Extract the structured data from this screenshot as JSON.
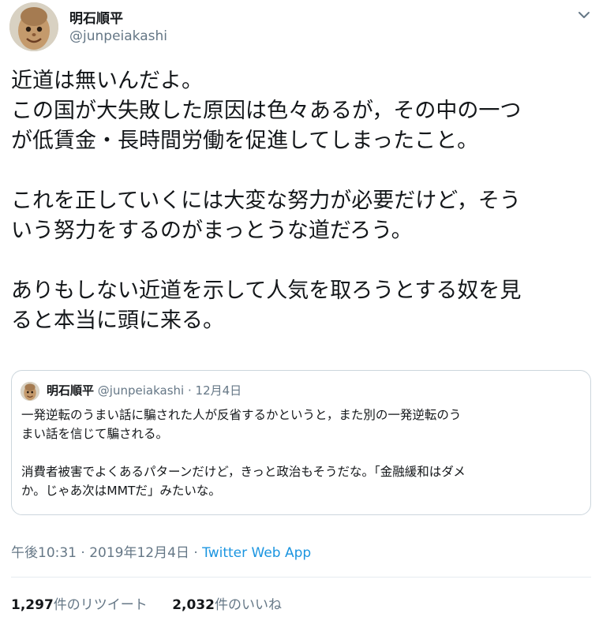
{
  "author": {
    "name": "明石順平",
    "handle": "@junpeiakashi"
  },
  "tweet": {
    "lines": [
      "近道は無いんだよ。",
      "この国が大失敗した原因は色々あるが，その中の一つ",
      "が低賃金・長時間労働を促進してしまったこと。",
      "",
      "これを正していくには大変な努力が必要だけど，そう",
      "いう努力をするのがまっとうな道だろう。",
      "",
      "ありもしない近道を示して人気を取ろうとする奴を見",
      "ると本当に頭に来る。"
    ]
  },
  "quote": {
    "name": "明石順平",
    "handle": "@junpeiakashi",
    "separator": "·",
    "date": "12月4日",
    "lines": [
      "一発逆転のうまい話に騙された人が反省するかというと，また別の一発逆転のう",
      "まい話を信じて騙される。",
      "",
      "消費者被害でよくあるパターンだけど，きっと政治もそうだな。「金融緩和はダメ",
      "か。じゃあ次はMMTだ」みたいな。"
    ]
  },
  "meta": {
    "time": "午後10:31",
    "separator1": "·",
    "date": "2019年12月4日",
    "separator2": "·",
    "source": "Twitter Web App"
  },
  "stats": {
    "retweets_count": "1,297",
    "retweets_label": "件のリツイート",
    "likes_count": "2,032",
    "likes_label": "件のいいね"
  },
  "icons": {
    "caret": "chevron-down-icon"
  },
  "colors": {
    "text": "#14171a",
    "secondary": "#657786",
    "link": "#1b95e0",
    "border": "#ccd6dd"
  }
}
